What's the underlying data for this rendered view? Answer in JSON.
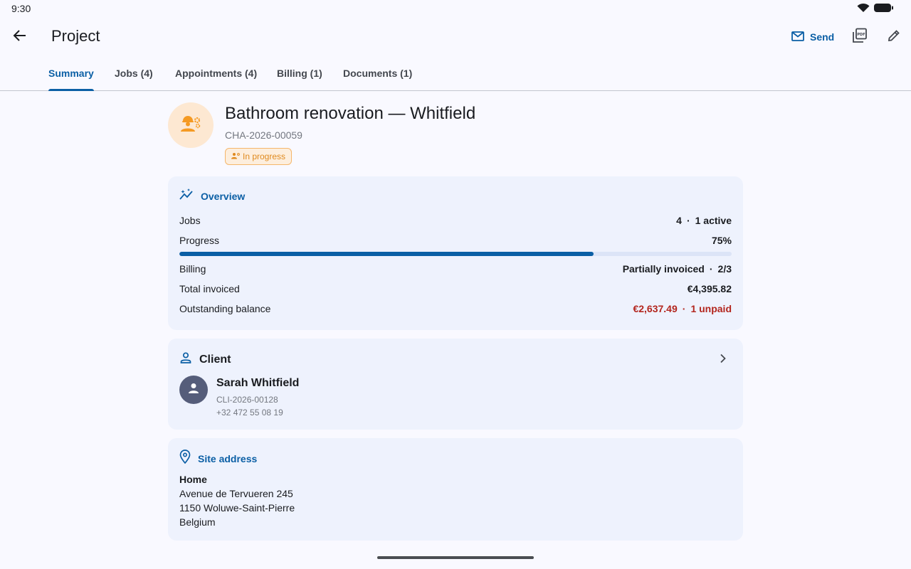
{
  "status_bar": {
    "time": "9:30",
    "wifi_icon": "wifi-icon",
    "battery_icon": "battery-icon"
  },
  "app_bar": {
    "title": "Project",
    "back_icon": "arrow-back-icon",
    "send_label": "Send",
    "send_icon": "mail-icon",
    "pdf_icon": "pdf-icon",
    "edit_icon": "pencil-icon"
  },
  "tabs": [
    {
      "label": "Summary",
      "active": true
    },
    {
      "label": "Jobs (4)",
      "active": false
    },
    {
      "label": "Appointments (4)",
      "active": false
    },
    {
      "label": "Billing (1)",
      "active": false
    },
    {
      "label": "Documents (1)",
      "active": false
    }
  ],
  "project": {
    "title": "Bathroom renovation — Whitfield",
    "code": "CHA-2026-00059",
    "status": "In progress",
    "avatar_icon": "worker-gear-icon"
  },
  "overview": {
    "title": "Overview",
    "icon": "insights-icon",
    "jobs_label": "Jobs",
    "jobs_count": "4",
    "jobs_active": "1 active",
    "progress_label": "Progress",
    "progress_value": "75%",
    "progress_fraction": 0.75,
    "billing_label": "Billing",
    "billing_status": "Partially invoiced",
    "billing_ratio": "2/3",
    "total_invoiced_label": "Total invoiced",
    "total_invoiced_value": "€4,395.82",
    "outstanding_label": "Outstanding balance",
    "outstanding_value": "€2,637.49",
    "outstanding_unpaid": "1 unpaid"
  },
  "client": {
    "title": "Client",
    "icon": "person-outline-icon",
    "name": "Sarah Whitfield",
    "code": "CLI-2026-00128",
    "phone": "+32 472 55 08 19"
  },
  "site_address": {
    "title": "Site address",
    "icon": "location-pin-icon",
    "label": "Home",
    "street": "Avenue de Tervueren 245",
    "city": "1150 Woluwe-Saint-Pierre",
    "country": "Belgium"
  },
  "colors": {
    "accent": "#0b5fa5",
    "status_orange": "#e08a1e",
    "danger": "#b3261e",
    "card_bg": "#eef2fd"
  }
}
